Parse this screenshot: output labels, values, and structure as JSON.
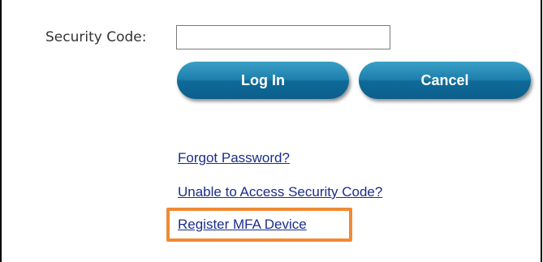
{
  "form": {
    "security_code_label": "Security Code:",
    "security_code_value": "",
    "security_code_placeholder": ""
  },
  "buttons": {
    "login_label": "Log In",
    "cancel_label": "Cancel"
  },
  "links": {
    "forgot_password": "Forgot Password?",
    "unable_to_access": "Unable to Access Security Code?",
    "register_mfa": "Register MFA Device"
  },
  "colors": {
    "button_blue": "#1d7fad",
    "link_blue": "#1a2e8c",
    "highlight_orange": "#f08a34"
  }
}
